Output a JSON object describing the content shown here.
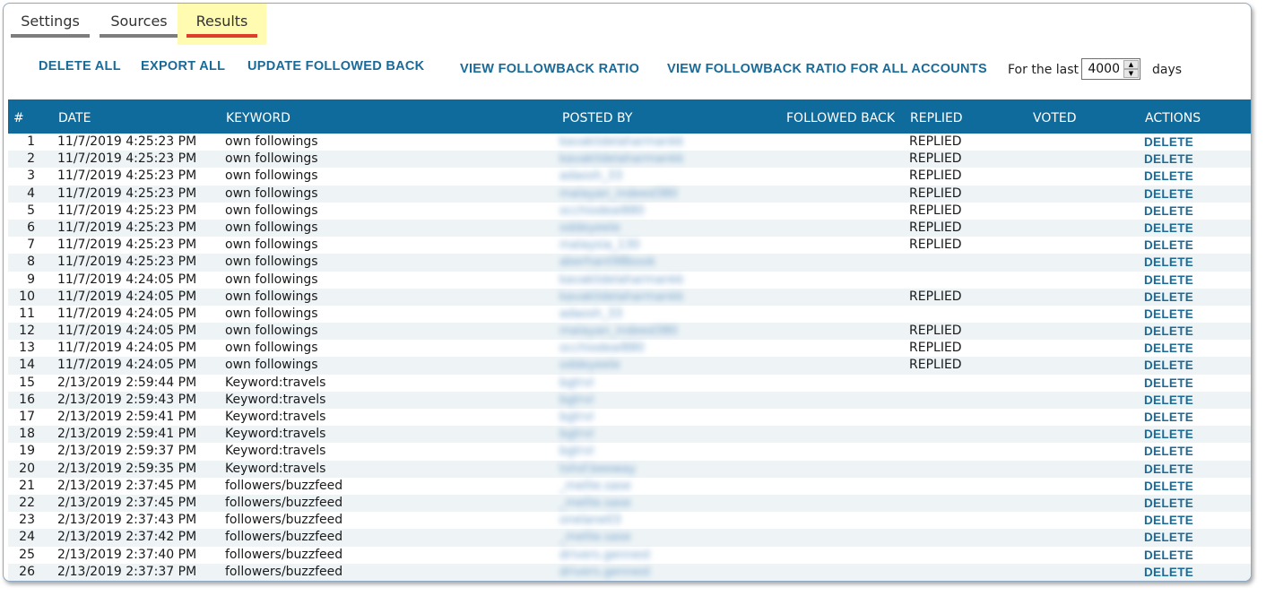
{
  "tabs": [
    {
      "label": "Settings",
      "active": false
    },
    {
      "label": "Sources",
      "active": false
    },
    {
      "label": "Results",
      "active": true
    }
  ],
  "toolbar": {
    "delete_all": "DELETE ALL",
    "export_all": "EXPORT ALL",
    "update_followed_back": "UPDATE FOLLOWED BACK",
    "view_ratio": "VIEW FOLLOWBACK RATIO",
    "view_ratio_all": "VIEW FOLLOWBACK RATIO FOR ALL ACCOUNTS",
    "for_the_last": "For the last",
    "days_value": "4000",
    "days_label": "days"
  },
  "table": {
    "headers": {
      "num": "#",
      "date": "DATE",
      "keyword": "KEYWORD",
      "posted_by": "POSTED BY",
      "followed_back": "FOLLOWED BACK",
      "replied": "REPLIED",
      "voted": "VOTED",
      "actions": "ACTIONS"
    },
    "rows": [
      {
        "num": "1",
        "date": "11/7/2019 4:25:23 PM",
        "keyword": "own followings",
        "posted_by": "kavaklidelaharmankk",
        "replied": "REPLIED",
        "action": "DELETE"
      },
      {
        "num": "2",
        "date": "11/7/2019 4:25:23 PM",
        "keyword": "own followings",
        "posted_by": "kavaklidelaharmankk",
        "replied": "REPLIED",
        "action": "DELETE"
      },
      {
        "num": "3",
        "date": "11/7/2019 4:25:23 PM",
        "keyword": "own followings",
        "posted_by": "adaosh_33",
        "replied": "REPLIED",
        "action": "DELETE"
      },
      {
        "num": "4",
        "date": "11/7/2019 4:25:23 PM",
        "keyword": "own followings",
        "posted_by": "malayan_indeed380",
        "replied": "REPLIED",
        "action": "DELETE"
      },
      {
        "num": "5",
        "date": "11/7/2019 4:25:23 PM",
        "keyword": "own followings",
        "posted_by": "occhiodeal880",
        "replied": "REPLIED",
        "action": "DELETE"
      },
      {
        "num": "6",
        "date": "11/7/2019 4:25:23 PM",
        "keyword": "own followings",
        "posted_by": "oddeyeele",
        "replied": "REPLIED",
        "action": "DELETE"
      },
      {
        "num": "7",
        "date": "11/7/2019 4:25:23 PM",
        "keyword": "own followings",
        "posted_by": "malaysia_130",
        "replied": "REPLIED",
        "action": "DELETE"
      },
      {
        "num": "8",
        "date": "11/7/2019 4:25:23 PM",
        "keyword": "own followings",
        "posted_by": "aberhant98book",
        "replied": "",
        "action": "DELETE"
      },
      {
        "num": "9",
        "date": "11/7/2019 4:24:05 PM",
        "keyword": "own followings",
        "posted_by": "kavaklidelaharmankk",
        "replied": "",
        "action": "DELETE"
      },
      {
        "num": "10",
        "date": "11/7/2019 4:24:05 PM",
        "keyword": "own followings",
        "posted_by": "kavaklidelaharmankk",
        "replied": "REPLIED",
        "action": "DELETE"
      },
      {
        "num": "11",
        "date": "11/7/2019 4:24:05 PM",
        "keyword": "own followings",
        "posted_by": "adaosh_33",
        "replied": "",
        "action": "DELETE"
      },
      {
        "num": "12",
        "date": "11/7/2019 4:24:05 PM",
        "keyword": "own followings",
        "posted_by": "malayan_indeed380",
        "replied": "REPLIED",
        "action": "DELETE"
      },
      {
        "num": "13",
        "date": "11/7/2019 4:24:05 PM",
        "keyword": "own followings",
        "posted_by": "occhiodeal880",
        "replied": "REPLIED",
        "action": "DELETE"
      },
      {
        "num": "14",
        "date": "11/7/2019 4:24:05 PM",
        "keyword": "own followings",
        "posted_by": "oddeyeele",
        "replied": "REPLIED",
        "action": "DELETE"
      },
      {
        "num": "15",
        "date": "2/13/2019 2:59:44 PM",
        "keyword": "Keyword:travels",
        "posted_by": "bgtrvl",
        "replied": "",
        "action": "DELETE"
      },
      {
        "num": "16",
        "date": "2/13/2019 2:59:43 PM",
        "keyword": "Keyword:travels",
        "posted_by": "bgtrvl",
        "replied": "",
        "action": "DELETE"
      },
      {
        "num": "17",
        "date": "2/13/2019 2:59:41 PM",
        "keyword": "Keyword:travels",
        "posted_by": "bgtrvl",
        "replied": "",
        "action": "DELETE"
      },
      {
        "num": "18",
        "date": "2/13/2019 2:59:41 PM",
        "keyword": "Keyword:travels",
        "posted_by": "bgtrvl",
        "replied": "",
        "action": "DELETE"
      },
      {
        "num": "19",
        "date": "2/13/2019 2:59:37 PM",
        "keyword": "Keyword:travels",
        "posted_by": "bgtrvl",
        "replied": "",
        "action": "DELETE"
      },
      {
        "num": "20",
        "date": "2/13/2019 2:59:35 PM",
        "keyword": "Keyword:travels",
        "posted_by": "tshsf.beeway",
        "replied": "",
        "action": "DELETE"
      },
      {
        "num": "21",
        "date": "2/13/2019 2:37:45 PM",
        "keyword": "followers/buzzfeed",
        "posted_by": "_mellie.sase",
        "replied": "",
        "action": "DELETE"
      },
      {
        "num": "22",
        "date": "2/13/2019 2:37:45 PM",
        "keyword": "followers/buzzfeed",
        "posted_by": "_mellie.sase",
        "replied": "",
        "action": "DELETE"
      },
      {
        "num": "23",
        "date": "2/13/2019 2:37:43 PM",
        "keyword": "followers/buzzfeed",
        "posted_by": "onelane03",
        "replied": "",
        "action": "DELETE"
      },
      {
        "num": "24",
        "date": "2/13/2019 2:37:42 PM",
        "keyword": "followers/buzzfeed",
        "posted_by": "_mellie.sase",
        "replied": "",
        "action": "DELETE"
      },
      {
        "num": "25",
        "date": "2/13/2019 2:37:40 PM",
        "keyword": "followers/buzzfeed",
        "posted_by": "drivers.gennest",
        "replied": "",
        "action": "DELETE"
      },
      {
        "num": "26",
        "date": "2/13/2019 2:37:37 PM",
        "keyword": "followers/buzzfeed",
        "posted_by": "drivers.gennest",
        "replied": "",
        "action": "DELETE"
      }
    ]
  },
  "colors": {
    "header_bg": "#0e6b9c",
    "link": "#1a6a98",
    "active_tab_bg": "#fffbb0",
    "active_tab_underline": "#e03c2e"
  }
}
